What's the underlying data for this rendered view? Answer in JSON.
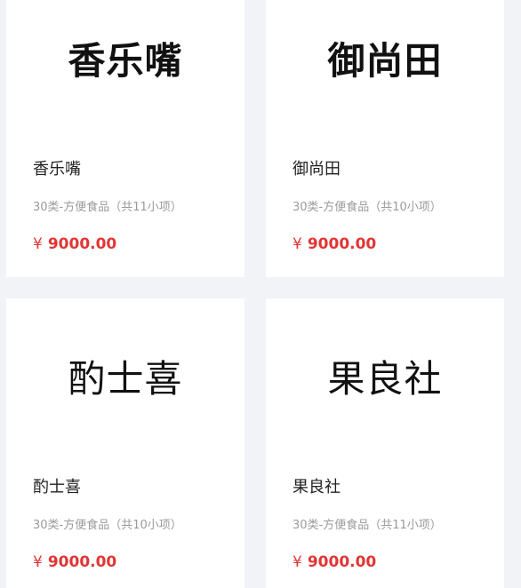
{
  "products": [
    {
      "logo_text": "香乐嘴",
      "name": "香乐嘴",
      "category": "30类-方便食品（共11小项）",
      "currency": "¥",
      "price": "9000.00"
    },
    {
      "logo_text": "御尚田",
      "name": "御尚田",
      "category": "30类-方便食品（共10小项）",
      "currency": "¥",
      "price": "9000.00"
    },
    {
      "logo_text": "酌士喜",
      "name": "酌士喜",
      "category": "30类-方便食品（共10小项）",
      "currency": "¥",
      "price": "9000.00"
    },
    {
      "logo_text": "果良社",
      "name": "果良社",
      "category": "30类-方便食品（共11小项）",
      "currency": "¥",
      "price": "9000.00"
    }
  ],
  "colors": {
    "page_background": "#f2f3f6",
    "card_background": "#ffffff",
    "price": "#e23535",
    "category_text": "#9a9a9a",
    "name_text": "#222222"
  }
}
